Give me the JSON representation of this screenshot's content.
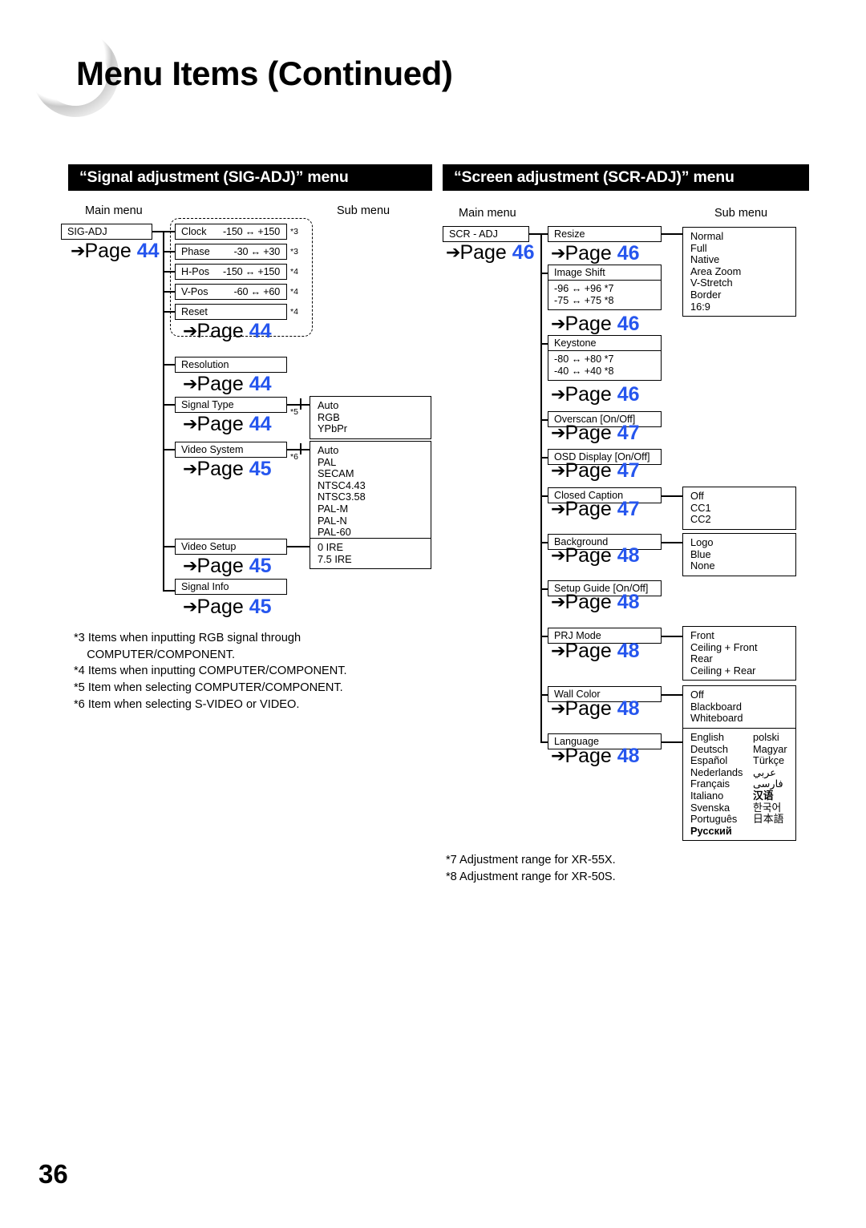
{
  "header": {
    "title": "Menu Items (Continued)",
    "page_number": "36"
  },
  "columns": {
    "main_menu_label": "Main menu",
    "sub_menu_label": "Sub menu"
  },
  "sections": [
    {
      "id": "sig-adj",
      "bar_title": "“Signal adjustment (SIG-ADJ)” menu",
      "main_menu": {
        "label": "SIG-ADJ",
        "page": "Page",
        "page_num": "44"
      },
      "group_page": {
        "label": "Page",
        "num": "44"
      },
      "items": [
        {
          "label": "Clock",
          "range": "-150 ↔ +150",
          "ast": "*3"
        },
        {
          "label": "Phase",
          "range": "-30 ↔  +30",
          "ast": "*3"
        },
        {
          "label": "H-Pos",
          "range": "-150 ↔ +150",
          "ast": "*4"
        },
        {
          "label": "V-Pos",
          "range": "-60 ↔  +60",
          "ast": "*4"
        },
        {
          "label": "Reset",
          "range": "",
          "ast": "*4"
        }
      ],
      "rows": [
        {
          "label": "Resolution",
          "page": "Page",
          "page_num": "44",
          "ast": "",
          "options": []
        },
        {
          "label": "Signal Type",
          "page": "Page",
          "page_num": "44",
          "ast": "*5",
          "options": [
            "Auto",
            "RGB",
            "YPbPr"
          ]
        },
        {
          "label": "Video System",
          "page": "Page",
          "page_num": "45",
          "ast": "*6",
          "options": [
            "Auto",
            "PAL",
            "SECAM",
            "NTSC4.43",
            "NTSC3.58",
            "PAL-M",
            "PAL-N",
            "PAL-60"
          ]
        },
        {
          "label": "Video Setup",
          "page": "Page",
          "page_num": "45",
          "ast": "",
          "options": [
            "0 IRE",
            "7.5 IRE"
          ]
        },
        {
          "label": "Signal Info",
          "page": "Page",
          "page_num": "45",
          "ast": "",
          "options": []
        }
      ],
      "footnotes": [
        "*3 Items when inputting RGB signal through\n    COMPUTER/COMPONENT.",
        "*4 Items when inputting COMPUTER/COMPONENT.",
        "*5 Item when selecting COMPUTER/COMPONENT.",
        "*6 Item when selecting S-VIDEO or VIDEO."
      ]
    },
    {
      "id": "scr-adj",
      "bar_title": "“Screen adjustment (SCR-ADJ)” menu",
      "main_menu": {
        "label": "SCR - ADJ",
        "page": "Page",
        "page_num": "46"
      },
      "rows": [
        {
          "label": "Resize",
          "page": "Page",
          "page_num": "46",
          "options": [
            "Normal",
            "Full",
            "Native",
            "Area Zoom",
            "V-Stretch",
            "Border",
            "16:9"
          ]
        },
        {
          "label": "Image Shift",
          "page": "Page",
          "page_num": "46",
          "ranges": [
            "-96 ↔ +96 *7",
            "-75 ↔ +75 *8"
          ]
        },
        {
          "label": "Keystone",
          "page": "Page",
          "page_num": "46",
          "ranges": [
            "-80 ↔ +80 *7",
            "-40 ↔ +40 *8"
          ]
        },
        {
          "label": "Overscan [On/Off]",
          "page": "Page",
          "page_num": "47",
          "options": []
        },
        {
          "label": "OSD Display [On/Off]",
          "page": "Page",
          "page_num": "47",
          "options": []
        },
        {
          "label": "Closed Caption",
          "page": "Page",
          "page_num": "47",
          "options": [
            "Off",
            "CC1",
            "CC2"
          ]
        },
        {
          "label": "Background",
          "page": "Page",
          "page_num": "48",
          "options": [
            "Logo",
            "Blue",
            "None"
          ]
        },
        {
          "label": "Setup Guide [On/Off]",
          "page": "Page",
          "page_num": "48",
          "options": []
        },
        {
          "label": "PRJ Mode",
          "page": "Page",
          "page_num": "48",
          "options": [
            "Front",
            "Ceiling + Front",
            "Rear",
            "Ceiling + Rear"
          ]
        },
        {
          "label": "Wall Color",
          "page": "Page",
          "page_num": "48",
          "options": [
            "Off",
            "Blackboard",
            "Whiteboard"
          ]
        },
        {
          "label": "Language",
          "page": "Page",
          "page_num": "48",
          "options_col1": [
            "English",
            "Deutsch",
            "Español",
            "Nederlands",
            "Français",
            "Italiano",
            "Svenska",
            "Português",
            "Русский"
          ],
          "options_col2": [
            "polski",
            "Magyar",
            "Türkçe",
            "عربي",
            "فارسی",
            "汉语",
            "한국어",
            "日本語"
          ]
        }
      ],
      "footnotes": [
        "*7 Adjustment range for XR-55X.",
        "*8 Adjustment range for XR-50S."
      ]
    }
  ],
  "colors": {
    "page_link_blue": "#2656ee",
    "bar_background": "#000000"
  }
}
